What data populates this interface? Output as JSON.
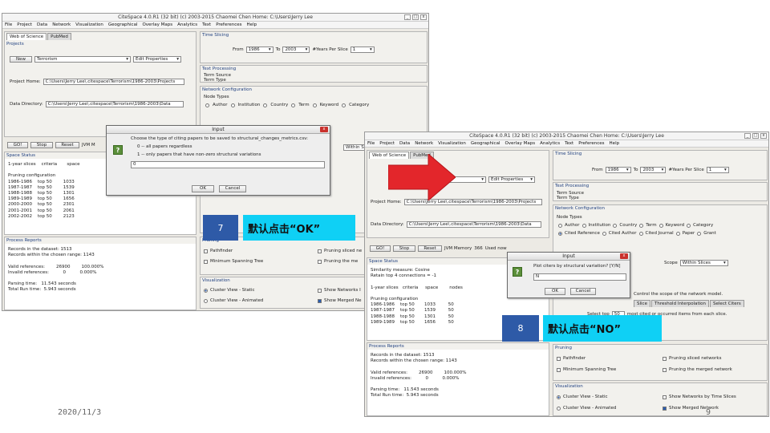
{
  "window1": {
    "title": "CiteSpace 4.0.R1 (32 bit)  (c) 2003-2015 Chaomei Chen   Home: C:\\Users\\Jerry Lee",
    "menu": [
      "File",
      "Project",
      "Data",
      "Network",
      "Visualization",
      "Geographical",
      "Overlay Maps",
      "Analytics",
      "Text",
      "Preferences",
      "Help"
    ],
    "tabs": [
      "Web of Science",
      "PubMed"
    ],
    "projects_label": "Projects",
    "new_button": "New",
    "project_name": "Terrorism",
    "edit_properties": "Edit Properties",
    "project_home_label": "Project Home:",
    "project_home": "C:\\Users\\Jerry Lee\\.citespace\\Terrorism\\1986-2003\\Projects",
    "data_dir_label": "Data Directory:",
    "data_dir": "C:\\Users\\Jerry Lee\\.citespace\\Terrorism\\1986-2003\\Data",
    "go_button": "GO!",
    "stop_button": "Stop",
    "reset_button": "Reset",
    "jvm_label": "JVM M",
    "space_status_label": "Space Status",
    "status_header": "1-year slices    criteria       space",
    "status_lines": "\n\nPruning configuration\n1986-1986    top 50        1033\n1987-1987    top 50        1539\n1988-1988    top 50        1301\n1989-1989    top 50        1656\n2000-2000    top 50        2301\n2001-2001    top 50        2061\n2002-2002    top 50        2123",
    "process_reports_label": "Process Reports",
    "report_lines": "Records in the dataset: 1513\nRecords within the chosen range: 1143\n\nValid references:        26900        100.000%\nInvalid references:          0          0.000%\n\nParsing time:   11.543 seconds\nTotal Run time:  5.943 seconds",
    "time_slicing_label": "Time Slicing",
    "from_label": "From",
    "from_value": "1986",
    "to_label": "To",
    "to_value": "2003",
    "years_per_slice_label": "#Years Per Slice",
    "years_per_slice": "1",
    "text_processing_label": "Text Processing",
    "term_source_label": "Term Source",
    "term_type_label": "Term Type",
    "network_config_label": "Network Configuration",
    "node_types_label": "Node Types",
    "node_types": [
      "Author",
      "Institution",
      "Country",
      "Term",
      "Keyword",
      "Category"
    ],
    "within_slices": "Within S",
    "pruning_label": "Pruning",
    "pathfinder": "Pathfinder",
    "mst": "Minimum Spanning Tree",
    "pruning_sliced": "Pruning sliced ne",
    "pruning_merged": "Pruning the me",
    "visualization_label": "Visualization",
    "cluster_static": "Cluster View - Static",
    "cluster_animated": "Cluster View - Animated",
    "show_networks": "Show Networks I",
    "show_merged": "Show Merged Ne"
  },
  "dialog1": {
    "title": "Input",
    "question": "Choose the type of citing papers to be saved to structural_changes_metrics.csv:",
    "option0": "0 -- all papers regardless",
    "option1": "1 -- only papers that have non-zero structural variations",
    "value": "0",
    "ok": "OK",
    "cancel": "Cancel"
  },
  "window2": {
    "title": "CiteSpace 4.0.R1 (32 bit)  (c) 2003-2015 Chaomei Chen   Home: C:\\Users\\Jerry Lee",
    "menu": [
      "File",
      "Project",
      "Data",
      "Network",
      "Visualization",
      "Geographical",
      "Overlay Maps",
      "Analytics",
      "Text",
      "Preferences",
      "Help"
    ],
    "tabs": [
      "Web of Science",
      "PubMed"
    ],
    "edit_properties": "Edit Properties",
    "project_home_label": "Project Home:",
    "project_home": "C:\\Users\\Jerry Lee\\.citespace\\Terrorism\\1986-2003\\Projects",
    "data_dir_label": "Data Directory:",
    "data_dir": "C:\\Users\\Jerry Lee\\.citespace\\Terrorism\\1986-2003\\Data",
    "go_button": "GO!",
    "stop_button": "Stop",
    "reset_button": "Reset",
    "jvm_label": "JVM Memory",
    "jvm_value": "366",
    "jvm_used": "Used now",
    "space_status_label": "Space Status",
    "status_lines": "Similarity measure: Cosine\nRetain top 4 connections = -1\n\n1-year slices   criteria     space        nodes\n\nPruning configuration\n1986-1986    top 50       1033         50\n1987-1987    top 50       1539         50\n1988-1988    top 50       1301         50\n1989-1989    top 50       1656         50",
    "process_reports_label": "Process Reports",
    "report_lines": "Records in the dataset: 1513\nRecords within the chosen range: 1143\n\nValid references:        26900        100.000%\nInvalid references:          0          0.000%\n\nParsing time:   11.543 seconds\nTotal Run time:  5.943 seconds",
    "time_slicing_label": "Time Slicing",
    "from_label": "From",
    "from_value": "1986",
    "to_label": "To",
    "to_value": "2003",
    "years_per_slice_label": "#Years Per Slice",
    "years_per_slice": "1",
    "text_processing_label": "Text Processing",
    "term_source_label": "Term Source",
    "term_type_label": "Term Type",
    "network_config_label": "Network Configuration",
    "node_types_label": "Node Types",
    "node_types_row1": [
      "Author",
      "Institution",
      "Country",
      "Term",
      "Keyword",
      "Category"
    ],
    "node_types_row2": [
      "Cited Reference",
      "Cited Author",
      "Cited Journal",
      "Paper",
      "Grant"
    ],
    "scope_label": "Scope",
    "scope_value": "Within Slices",
    "control_text": "Control the scope of the network model.",
    "tab_slice": "Slice",
    "tab_threshold": "Threshold Interpolation",
    "tab_select": "Select Citers",
    "select_top_label": "Select top",
    "select_top_value": "50",
    "select_top_suffix": "most cited or occurred items from each slice.",
    "pruning_label": "Pruning",
    "pathfinder": "Pathfinder",
    "mst": "Minimum Spanning Tree",
    "pruning_sliced": "Pruning sliced networks",
    "pruning_merged": "Pruning the merged network",
    "visualization_label": "Visualization",
    "cluster_static": "Cluster View - Static",
    "cluster_animated": "Cluster View - Animated",
    "show_networks": "Show Networks by Time Slices",
    "show_merged": "Show Merged Network"
  },
  "dialog2": {
    "title": "Input",
    "question": "Plot citers by structural variation? [Y/N]",
    "value": "N",
    "ok": "OK",
    "cancel": "Cancel"
  },
  "annotations": {
    "step7_number": "7",
    "step7_text": "默认点击“OK”",
    "step8_number": "8",
    "step8_text": "默认点击“NO”"
  },
  "footer": {
    "date": "2020/11/3",
    "page": "9"
  },
  "colors": {
    "callout": "#0fd0f5",
    "badge": "#2e5aa7",
    "arrow": "#e3262b"
  }
}
